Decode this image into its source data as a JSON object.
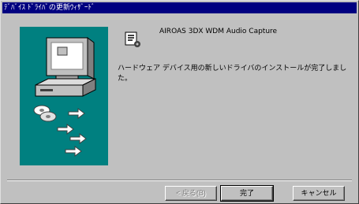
{
  "window": {
    "title": "ﾃﾞﾊﾞｲｽ ﾄﾞﾗｲﾊﾞの更新ｳｨｻﾞｰﾄﾞ"
  },
  "device": {
    "name": "AIROAS 3DX WDM Audio Capture",
    "icon": "sound-device-icon"
  },
  "message": {
    "text": "ハードウェア デバイス用の新しいドライバのインストールが完了しました。"
  },
  "buttons": {
    "back": "< 戻る(B)",
    "finish": "完了",
    "cancel": "キャンセル"
  },
  "colors": {
    "title_bar": "#000080",
    "illustration_bg": "#008080",
    "dialog_bg": "#c0c0c0"
  }
}
